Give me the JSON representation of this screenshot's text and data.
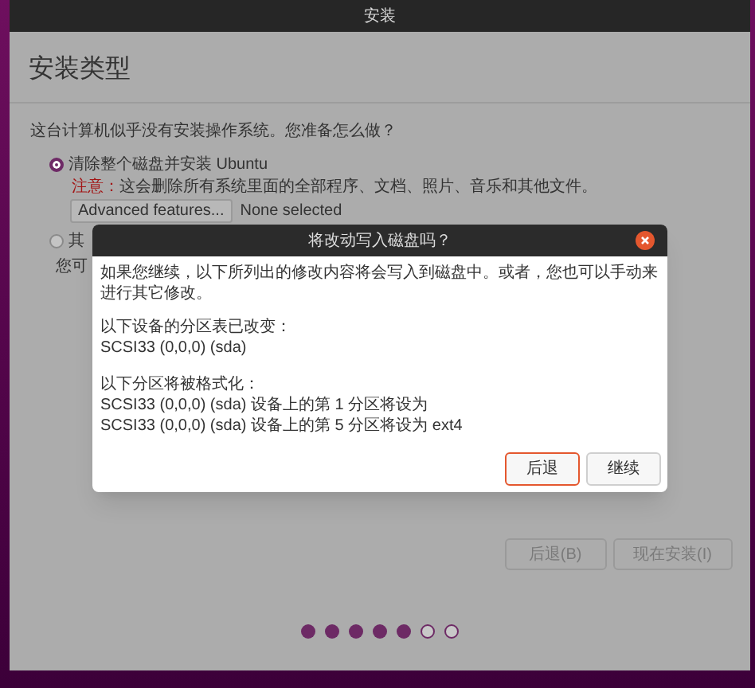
{
  "window": {
    "title": "安装"
  },
  "page": {
    "heading": "安装类型",
    "question": "这台计算机似乎没有安装操作系统。您准备怎么做？"
  },
  "options": [
    {
      "label": "清除整个磁盘并安装 Ubuntu",
      "selected": true,
      "warning_label": "注意：",
      "warning": "这会删除所有系统里面的全部程序、文档、照片、音乐和其他文件。",
      "advanced_button": "Advanced features...",
      "advanced_value": "None selected"
    },
    {
      "label": "其",
      "selected": false,
      "description": "您可"
    }
  ],
  "buttons": [
    {
      "label": "后退(B)"
    },
    {
      "label": "现在安装(I)"
    }
  ],
  "progress_dots": [
    {
      "filled": true
    },
    {
      "filled": true
    },
    {
      "filled": true
    },
    {
      "filled": true
    },
    {
      "filled": true
    },
    {
      "filled": false
    },
    {
      "filled": false
    }
  ],
  "dialog": {
    "title": "将改动写入磁盘吗？",
    "intro": "如果您继续，以下所列出的修改内容将会写入到磁盘中。或者，您也可以手动来进行其它修改。",
    "sections": [
      {
        "heading": "以下设备的分区表已改变：",
        "lines": [
          "SCSI33 (0,0,0) (sda)"
        ]
      },
      {
        "heading": "以下分区将被格式化：",
        "lines": [
          "SCSI33 (0,0,0) (sda) 设备上的第 1 分区将设为",
          "SCSI33 (0,0,0) (sda) 设备上的第 5 分区将设为 ext4"
        ]
      }
    ],
    "buttons": [
      {
        "label": "后退",
        "focused": true
      },
      {
        "label": "继续",
        "focused": false
      }
    ]
  }
}
